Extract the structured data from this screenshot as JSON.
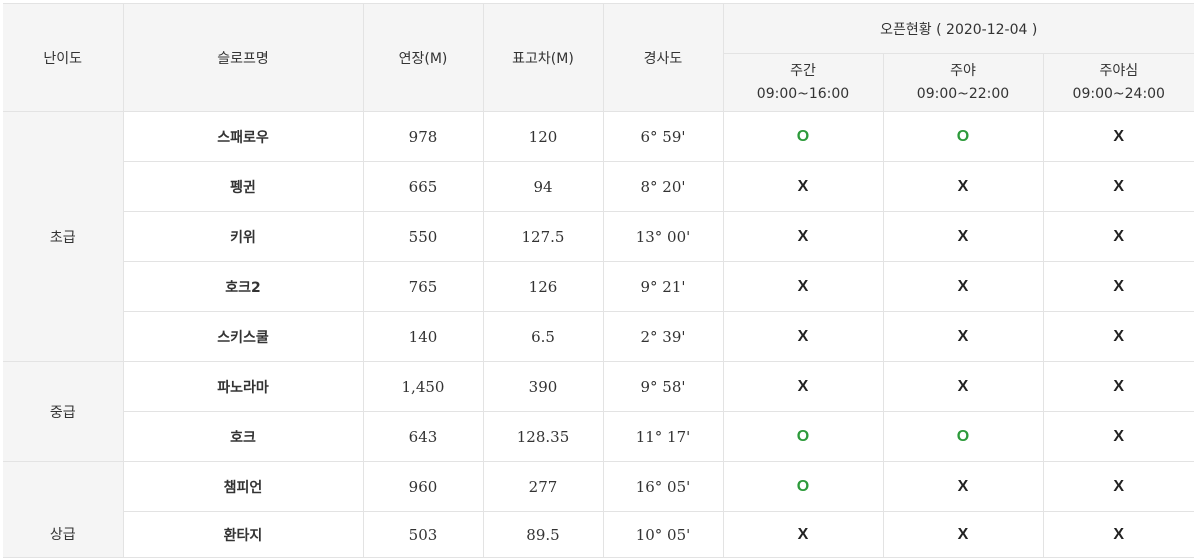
{
  "header": {
    "level": "난이도",
    "slope_name": "슬로프명",
    "length": "연장(M)",
    "elevation": "표고차(M)",
    "gradient": "경사도",
    "open_status": "오픈현황 ( 2020-12-04 )",
    "periods": [
      {
        "label": "주간",
        "time": "09:00~16:00"
      },
      {
        "label": "주야",
        "time": "09:00~22:00"
      },
      {
        "label": "주야심",
        "time": "09:00~24:00"
      }
    ]
  },
  "levels": [
    "초급",
    "중급",
    "상급"
  ],
  "rows": [
    {
      "name": "스패로우",
      "length": "978",
      "elevation": "120",
      "gradient": "6° 59'",
      "status": [
        "O",
        "O",
        "X"
      ]
    },
    {
      "name": "펭귄",
      "length": "665",
      "elevation": "94",
      "gradient": "8° 20'",
      "status": [
        "X",
        "X",
        "X"
      ]
    },
    {
      "name": "키위",
      "length": "550",
      "elevation": "127.5",
      "gradient": "13° 00'",
      "status": [
        "X",
        "X",
        "X"
      ]
    },
    {
      "name": "호크2",
      "length": "765",
      "elevation": "126",
      "gradient": "9° 21'",
      "status": [
        "X",
        "X",
        "X"
      ]
    },
    {
      "name": "스키스쿨",
      "length": "140",
      "elevation": "6.5",
      "gradient": "2° 39'",
      "status": [
        "X",
        "X",
        "X"
      ]
    },
    {
      "name": "파노라마",
      "length": "1,450",
      "elevation": "390",
      "gradient": "9° 58'",
      "status": [
        "X",
        "X",
        "X"
      ]
    },
    {
      "name": "호크",
      "length": "643",
      "elevation": "128.35",
      "gradient": "11° 17'",
      "status": [
        "O",
        "O",
        "X"
      ]
    },
    {
      "name": "챔피언",
      "length": "960",
      "elevation": "277",
      "gradient": "16° 05'",
      "status": [
        "O",
        "X",
        "X"
      ]
    },
    {
      "name": "환타지",
      "length": "503",
      "elevation": "89.5",
      "gradient": "10° 05'",
      "status": [
        "X",
        "X",
        "X"
      ]
    }
  ],
  "colors": {
    "open": "#2c9a3a",
    "closed": "#222222",
    "header_bg": "#f5f5f5",
    "border": "#e3e3e3"
  }
}
